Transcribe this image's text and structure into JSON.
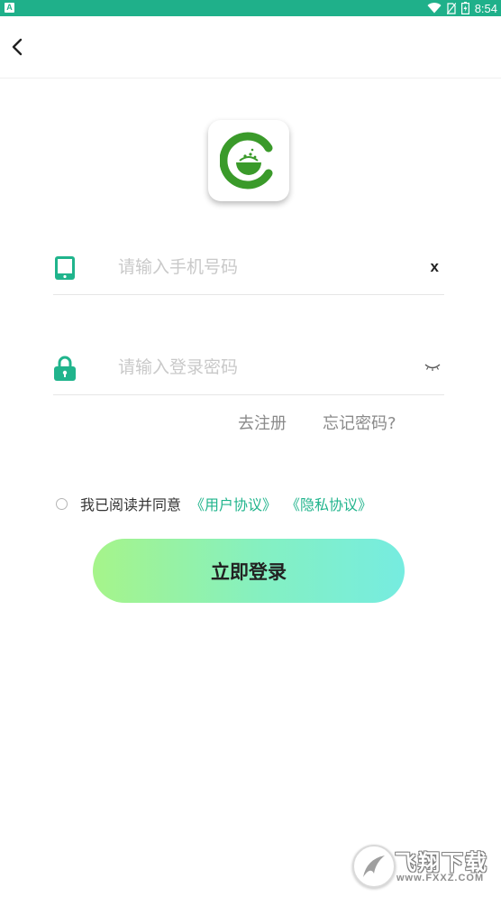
{
  "status_bar": {
    "left_badge": "A",
    "time": "8:54",
    "icons": [
      "wifi-icon",
      "no-sim-icon",
      "battery-icon"
    ]
  },
  "nav": {
    "back_icon": "chevron-left-icon"
  },
  "logo": {
    "icon": "app-logo-icon",
    "brand_color": "#3a9a2a"
  },
  "phone_field": {
    "icon": "tablet-phone-icon",
    "placeholder": "请输入手机号码",
    "value": "",
    "clear_label": "x"
  },
  "password_field": {
    "icon": "lock-icon",
    "placeholder": "请输入登录密码",
    "value": "",
    "toggle_icon": "eye-closed-icon"
  },
  "links": {
    "register": "去注册",
    "forgot": "忘记密码?"
  },
  "agreement": {
    "checked": false,
    "text": "我已阅读并同意",
    "user_agreement": "《用户协议》",
    "privacy_policy": "《隐私协议》"
  },
  "login_button": {
    "label": "立即登录"
  },
  "colors": {
    "accent": "#20b48c",
    "status_bar": "#1fb08a",
    "button_gradient_start": "#a6f48a",
    "button_gradient_end": "#76ece0"
  },
  "watermark": {
    "title": "飞翔下载",
    "url": "www.FXXZ.COM"
  }
}
